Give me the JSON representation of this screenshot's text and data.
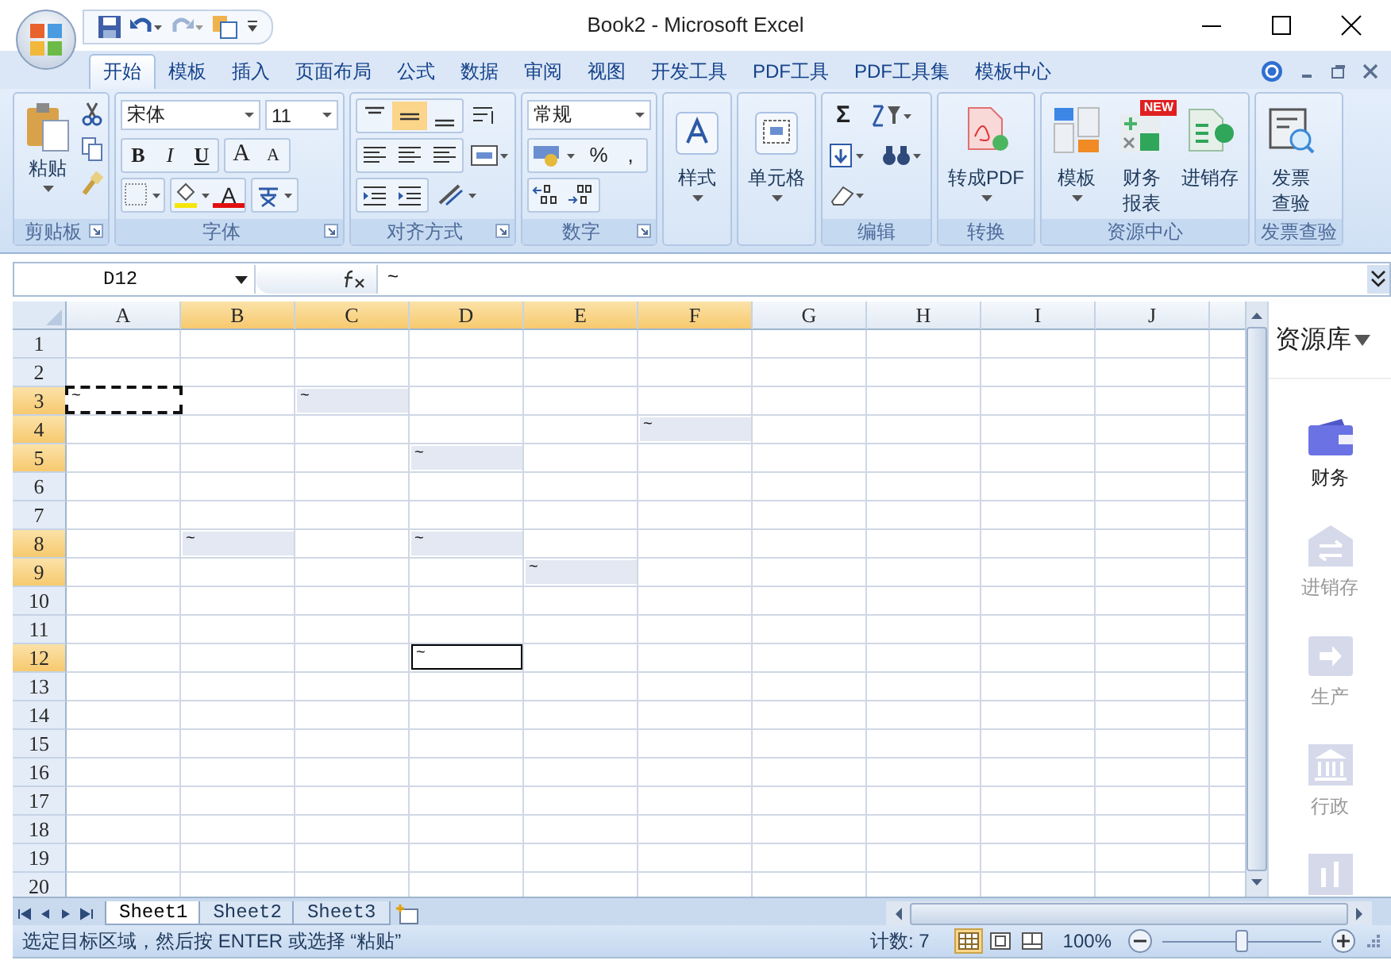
{
  "window": {
    "title": "Book2 - Microsoft Excel"
  },
  "tabs": [
    {
      "label": "开始",
      "selected": true
    },
    {
      "label": "模板",
      "selected": false
    },
    {
      "label": "插入",
      "selected": false
    },
    {
      "label": "页面布局",
      "selected": false
    },
    {
      "label": "公式",
      "selected": false
    },
    {
      "label": "数据",
      "selected": false
    },
    {
      "label": "审阅",
      "selected": false
    },
    {
      "label": "视图",
      "selected": false
    },
    {
      "label": "开发工具",
      "selected": false
    },
    {
      "label": "PDF工具",
      "selected": false
    },
    {
      "label": "PDF工具集",
      "selected": false
    },
    {
      "label": "模板中心",
      "selected": false
    }
  ],
  "ribbon": [
    {
      "kind": "clipboard",
      "label": "剪贴板",
      "launcher": true,
      "paste": "粘贴"
    },
    {
      "kind": "font",
      "label": "字体",
      "launcher": true,
      "font": "宋体",
      "size": "11",
      "buttons": [
        {
          "label": "B",
          "kind": "bold"
        },
        {
          "label": "I",
          "kind": "italic"
        },
        {
          "label": "U",
          "kind": "underline"
        },
        {
          "label": "A",
          "kind": "grow"
        },
        {
          "label": "A",
          "kind": "shrink"
        }
      ],
      "font_color": "A"
    },
    {
      "kind": "alignment",
      "label": "对齐方式",
      "launcher": true,
      "vertical": [
        {
          "selected": false
        },
        {
          "selected": true
        },
        {
          "selected": false
        }
      ]
    },
    {
      "kind": "number",
      "label": "数字",
      "launcher": true,
      "format": "常规",
      "buttons": [
        "%",
        ","
      ]
    },
    {
      "kind": "large",
      "buttons": [
        {
          "label": "样式",
          "dropdown": true,
          "kind": "styles"
        }
      ]
    },
    {
      "kind": "large",
      "buttons": [
        {
          "label": "单元格",
          "dropdown": true,
          "kind": "cells"
        }
      ]
    },
    {
      "kind": "editing",
      "label": "编辑",
      "launcher": false,
      "sum": "Σ"
    },
    {
      "kind": "large",
      "label": "转换",
      "buttons": [
        {
          "label": "转成PDF",
          "dropdown": true,
          "kind": "pdf"
        }
      ]
    },
    {
      "kind": "large",
      "label": "资源中心",
      "buttons": [
        {
          "label": "模板",
          "dropdown": true,
          "kind": "template"
        },
        {
          "label": "财务报表",
          "dropdown": false,
          "kind": "finance",
          "badge": "NEW"
        },
        {
          "label": "进销存",
          "dropdown": false,
          "kind": "inventory"
        }
      ]
    },
    {
      "kind": "large",
      "label": "发票查验",
      "buttons": [
        {
          "label": "发票查验",
          "dropdown": false,
          "kind": "invoice"
        }
      ]
    }
  ],
  "name_box": "D12",
  "formula": "~",
  "columns": [
    {
      "label": "A",
      "selected": false
    },
    {
      "label": "B",
      "selected": true
    },
    {
      "label": "C",
      "selected": true
    },
    {
      "label": "D",
      "selected": true
    },
    {
      "label": "E",
      "selected": true
    },
    {
      "label": "F",
      "selected": true
    },
    {
      "label": "G",
      "selected": false
    },
    {
      "label": "H",
      "selected": false
    },
    {
      "label": "I",
      "selected": false
    },
    {
      "label": "J",
      "selected": false
    }
  ],
  "rows": [
    {
      "label": "1",
      "selected": false
    },
    {
      "label": "2",
      "selected": false
    },
    {
      "label": "3",
      "selected": true,
      "cells": [
        {
          "text": "~",
          "kind": "marquee"
        },
        {},
        {
          "text": "~",
          "kind": "selected"
        }
      ]
    },
    {
      "label": "4",
      "selected": true,
      "cells": [
        {},
        {},
        {},
        {},
        {},
        {
          "text": "~",
          "kind": "selected"
        }
      ]
    },
    {
      "label": "5",
      "selected": true,
      "cells": [
        {},
        {},
        {},
        {
          "text": "~",
          "kind": "selected"
        }
      ]
    },
    {
      "label": "6",
      "selected": false
    },
    {
      "label": "7",
      "selected": false
    },
    {
      "label": "8",
      "selected": true,
      "cells": [
        {},
        {
          "text": "~",
          "kind": "selected"
        },
        {},
        {
          "text": "~",
          "kind": "selected"
        }
      ]
    },
    {
      "label": "9",
      "selected": true,
      "cells": [
        {},
        {},
        {},
        {},
        {
          "text": "~",
          "kind": "selected"
        }
      ]
    },
    {
      "label": "10",
      "selected": false
    },
    {
      "label": "11",
      "selected": false
    },
    {
      "label": "12",
      "selected": true,
      "cells": [
        {},
        {},
        {},
        {
          "text": "~",
          "kind": "active"
        }
      ]
    },
    {
      "label": "13",
      "selected": false
    },
    {
      "label": "14",
      "selected": false
    },
    {
      "label": "15",
      "selected": false
    },
    {
      "label": "16",
      "selected": false
    },
    {
      "label": "17",
      "selected": false
    },
    {
      "label": "18",
      "selected": false
    },
    {
      "label": "19",
      "selected": false
    },
    {
      "label": "20",
      "selected": false
    }
  ],
  "sheet_tabs": [
    {
      "label": "Sheet1",
      "selected": true
    },
    {
      "label": "Sheet2",
      "selected": false
    },
    {
      "label": "Sheet3",
      "selected": false
    }
  ],
  "status": {
    "message": "选定目标区域，然后按 ENTER 或选择 “粘贴”",
    "count": "计数: 7",
    "zoom": "100%",
    "zoom_slider": {
      "level": 0.5
    },
    "views": [
      {
        "kind": "normal",
        "selected": true
      },
      {
        "kind": "layout",
        "selected": false
      },
      {
        "kind": "pagebreak",
        "selected": false
      }
    ]
  },
  "sidebar": {
    "title": "资源库",
    "items": [
      {
        "label": "财务",
        "selected": true,
        "kind": "wallet"
      },
      {
        "label": "进销存",
        "selected": false,
        "kind": "exchange"
      },
      {
        "label": "生产",
        "selected": false,
        "kind": "arrow"
      },
      {
        "label": "行政",
        "selected": false,
        "kind": "bank"
      },
      {
        "selected": false,
        "kind": "chart"
      }
    ]
  }
}
